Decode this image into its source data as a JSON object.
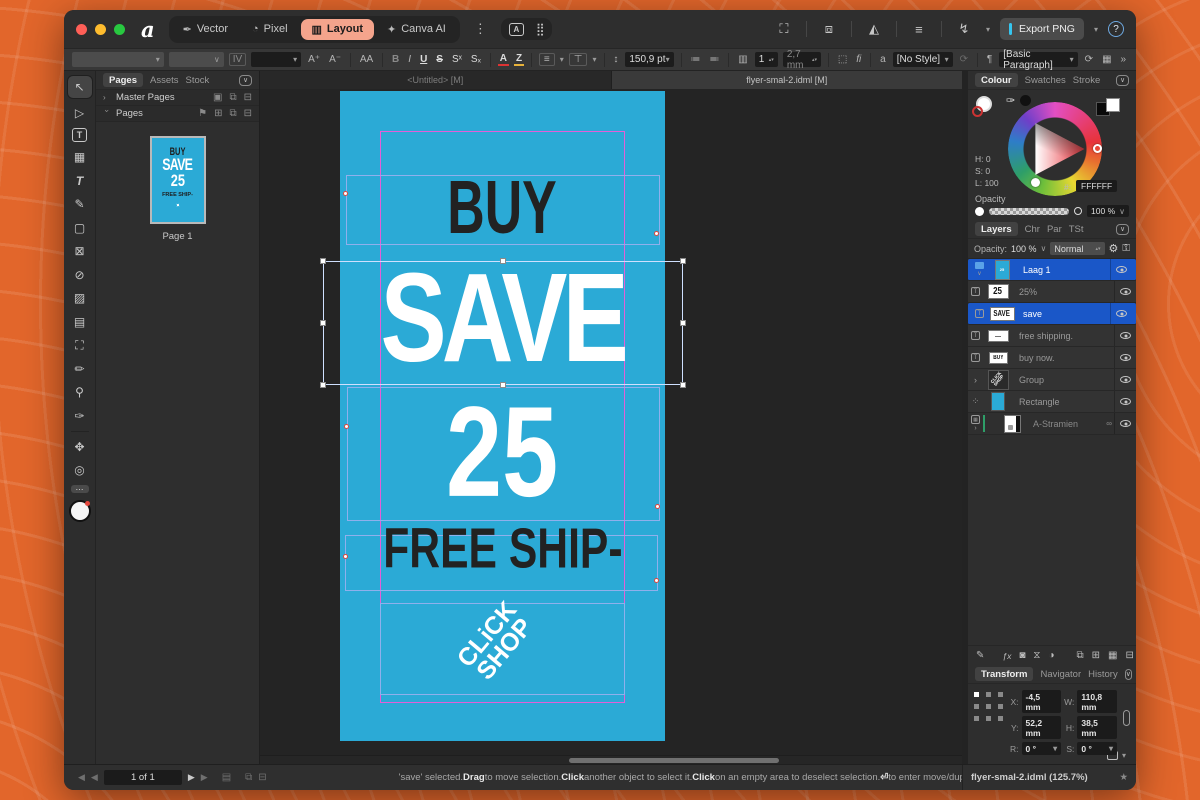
{
  "colors": {
    "accent_blue": "#1a57c8",
    "persona_active": "#f4a48c",
    "flyer_cyan": "#2baad6",
    "export_cyan": "#35c5ef",
    "desktop_orange": "#e2662b",
    "guide_magenta": "#e45fd8",
    "frame_blue": "#8fb0ec"
  },
  "titlebar": {
    "personas": [
      {
        "label": "Vector"
      },
      {
        "label": "Pixel"
      },
      {
        "label": "Layout"
      },
      {
        "label": "Canva AI"
      }
    ],
    "export_label": "Export PNG",
    "help": "?"
  },
  "glyphs": {
    "vector": "✒",
    "pixel": "◔",
    "layout": "▥",
    "canva": "✦",
    "menu_dots": "⋮",
    "translate": "A",
    "grid_dots": "⣿",
    "marquee": "⛶",
    "link_objects": "⧈",
    "flip": "◭",
    "align": "≡",
    "wand": "↯",
    "caret": "▾",
    "chevron": "∨",
    "expand": "›",
    "a_plus": "A⁺",
    "a_minus": "A⁻",
    "aa": "AA",
    "bold": "B",
    "italic": "I",
    "underline": "U",
    "strike": "S",
    "superscript": "Sˣ",
    "subscript": "Sₓ",
    "font_colour": "A",
    "highlighter": "Z",
    "align_para": "≡",
    "baseline": "⊤",
    "leading": "↕",
    "bullet_list": "≔",
    "numbered_list": "≕",
    "columns": "▥",
    "text_frame": "⬚",
    "ligature": "fi",
    "char_style_a": "a",
    "pilcrow": "¶",
    "sync": "⟳",
    "style_grid": "▦",
    "overflow": "»",
    "move": "↖",
    "node": "▷",
    "frame_text": "T",
    "table": "▦",
    "artistic_text": "T",
    "pen": "✎",
    "rectangle": "▢",
    "picture_rect": "⊠",
    "picture_ellipse": "⊘",
    "place_image": "▨",
    "asset_pages": "▤",
    "crop": "⛶",
    "pencil": "✏",
    "style_picker": "⚲",
    "eyedropper": "✑",
    "pan": "✥",
    "zoom": "◎",
    "more": "⋯",
    "pin": "⚑",
    "add_page": "⊞",
    "clone": "⧉",
    "trash": "⊟",
    "add_master": "▣",
    "gear": "⚙",
    "lock": "⚿",
    "edit": "✎",
    "fx": "ƒx",
    "mask": "◙",
    "adjustment": "⧖",
    "half": "◑",
    "copy": "⧉",
    "folder": "⊞",
    "checker": "▦",
    "nav_first": "◀",
    "nav_prev": "◀",
    "nav_next": "▶",
    "nav_last": "▶",
    "star": "★",
    "link_small": "∞",
    "transform_node": "⁘",
    "return_key": "⏎"
  },
  "context_toolbar": {
    "variant": "IV",
    "leading_value": "150,9 pt",
    "columns_value": "1",
    "gutter_value": "2,7 mm",
    "char_style": "[No Style]",
    "para_style": "[Basic Paragraph]"
  },
  "left_panel": {
    "tabs": [
      {
        "label": "Pages"
      },
      {
        "label": "Assets"
      },
      {
        "label": "Stock"
      }
    ],
    "sections": {
      "master": "Master Pages",
      "pages": "Pages"
    },
    "page_caption": "Page 1"
  },
  "doc_tabs": [
    {
      "label": "<Untitled> [M]"
    },
    {
      "label": "flyer-smal-2.idml [M]"
    }
  ],
  "flyer": {
    "line1": "BUY",
    "line2": "SAVE",
    "line3": "25",
    "line4": "FREE SHIP-",
    "logo_line1": "CLiCK",
    "logo_line2": "SHOP"
  },
  "colour_panel": {
    "tabs": [
      {
        "label": "Colour"
      },
      {
        "label": "Swatches"
      },
      {
        "label": "Stroke"
      }
    ],
    "h": "H: 0",
    "s": "S: 0",
    "l": "L: 100",
    "hex_label": "#:",
    "hex_value": "FFFFFF",
    "opacity_label": "Opacity",
    "opacity_value": "100 %"
  },
  "layers_panel": {
    "tabs": [
      {
        "label": "Layers"
      },
      {
        "label": "Chr"
      },
      {
        "label": "Par"
      },
      {
        "label": "TSt"
      }
    ],
    "opacity_label": "Opacity:",
    "opacity_value": "100 %",
    "blend_mode": "Normal",
    "rows": [
      {
        "name": "Laag 1"
      },
      {
        "name": "25%",
        "thumb": "25"
      },
      {
        "name": "save",
        "thumb": "SAVE"
      },
      {
        "name": "free shipping."
      },
      {
        "name": "buy now.",
        "thumb": "BUY"
      },
      {
        "name": "Group",
        "thumb1": "CLICK",
        "thumb2": "SHOP"
      },
      {
        "name": "Rectangle"
      },
      {
        "name": "A-Stramien"
      }
    ]
  },
  "transform_panel": {
    "tabs": [
      {
        "label": "Transform"
      },
      {
        "label": "Navigator"
      },
      {
        "label": "History"
      }
    ],
    "fields": [
      {
        "label": "X:",
        "value": "-4,5 mm"
      },
      {
        "label": "W:",
        "value": "110,8 mm"
      },
      {
        "label": "Y:",
        "value": "52,2 mm"
      },
      {
        "label": "H:",
        "value": "38,5 mm"
      },
      {
        "label": "R:",
        "value": "0 °"
      },
      {
        "label": "S:",
        "value": "0 °"
      }
    ]
  },
  "status_bar": {
    "page_nav": "1 of 1",
    "hint": {
      "s0": "'save' selected. ",
      "s1": "Drag",
      "s2": " to move selection. ",
      "s3": "Click",
      "s4": " another object to select it. ",
      "s5": "Click",
      "s6": " on an empty area to deselect selection. ",
      "s7": "⏎",
      "s8": " to enter move/duplicate values."
    },
    "doc_zoom": "flyer-smal-2.idml (125.7%)"
  }
}
